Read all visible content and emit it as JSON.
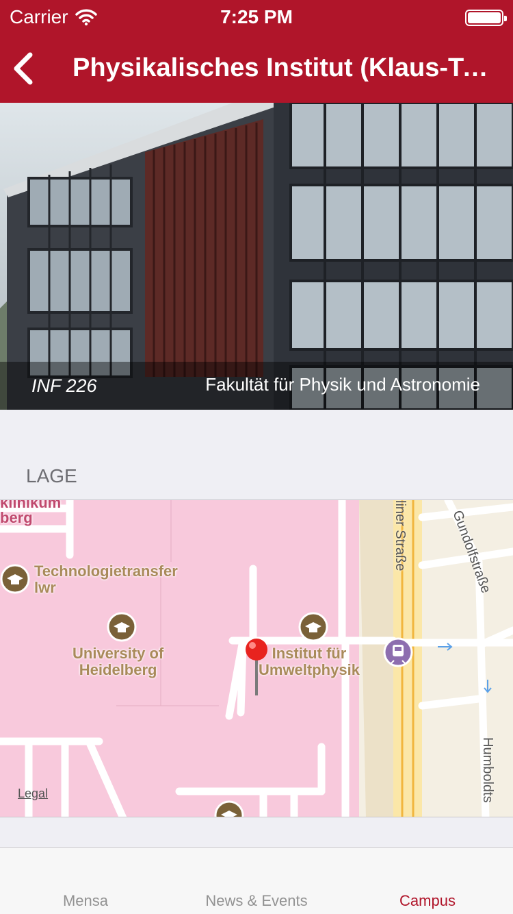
{
  "status": {
    "carrier": "Carrier",
    "time": "7:25 PM"
  },
  "nav": {
    "title": "Physikalisches Institut (Klaus-Tschira-Gebäude)"
  },
  "hero": {
    "code": "INF 226",
    "faculty": "Fakultät für Physik und Astronomie"
  },
  "section": {
    "header": "LAGE"
  },
  "map": {
    "labels": {
      "klinikum": "klinikum",
      "berg": "berg",
      "tech_line1": "Technologietransfer",
      "tech_line2": "lwr",
      "uni_line1": "University of",
      "uni_line2": "Heidelberg",
      "inst_line1": "Institut für",
      "inst_line2": "Umweltphysik",
      "street_berliner": "liner Straße",
      "street_gundolf": "Gundolfstraße",
      "street_humboldt": "Humboldts"
    },
    "legal": "Legal"
  },
  "tabs": [
    {
      "label": "Mensa"
    },
    {
      "label": "News & Events"
    },
    {
      "label": "Campus"
    }
  ],
  "colors": {
    "brand": "#b0152a",
    "campus_area": "#f8c9dc"
  }
}
